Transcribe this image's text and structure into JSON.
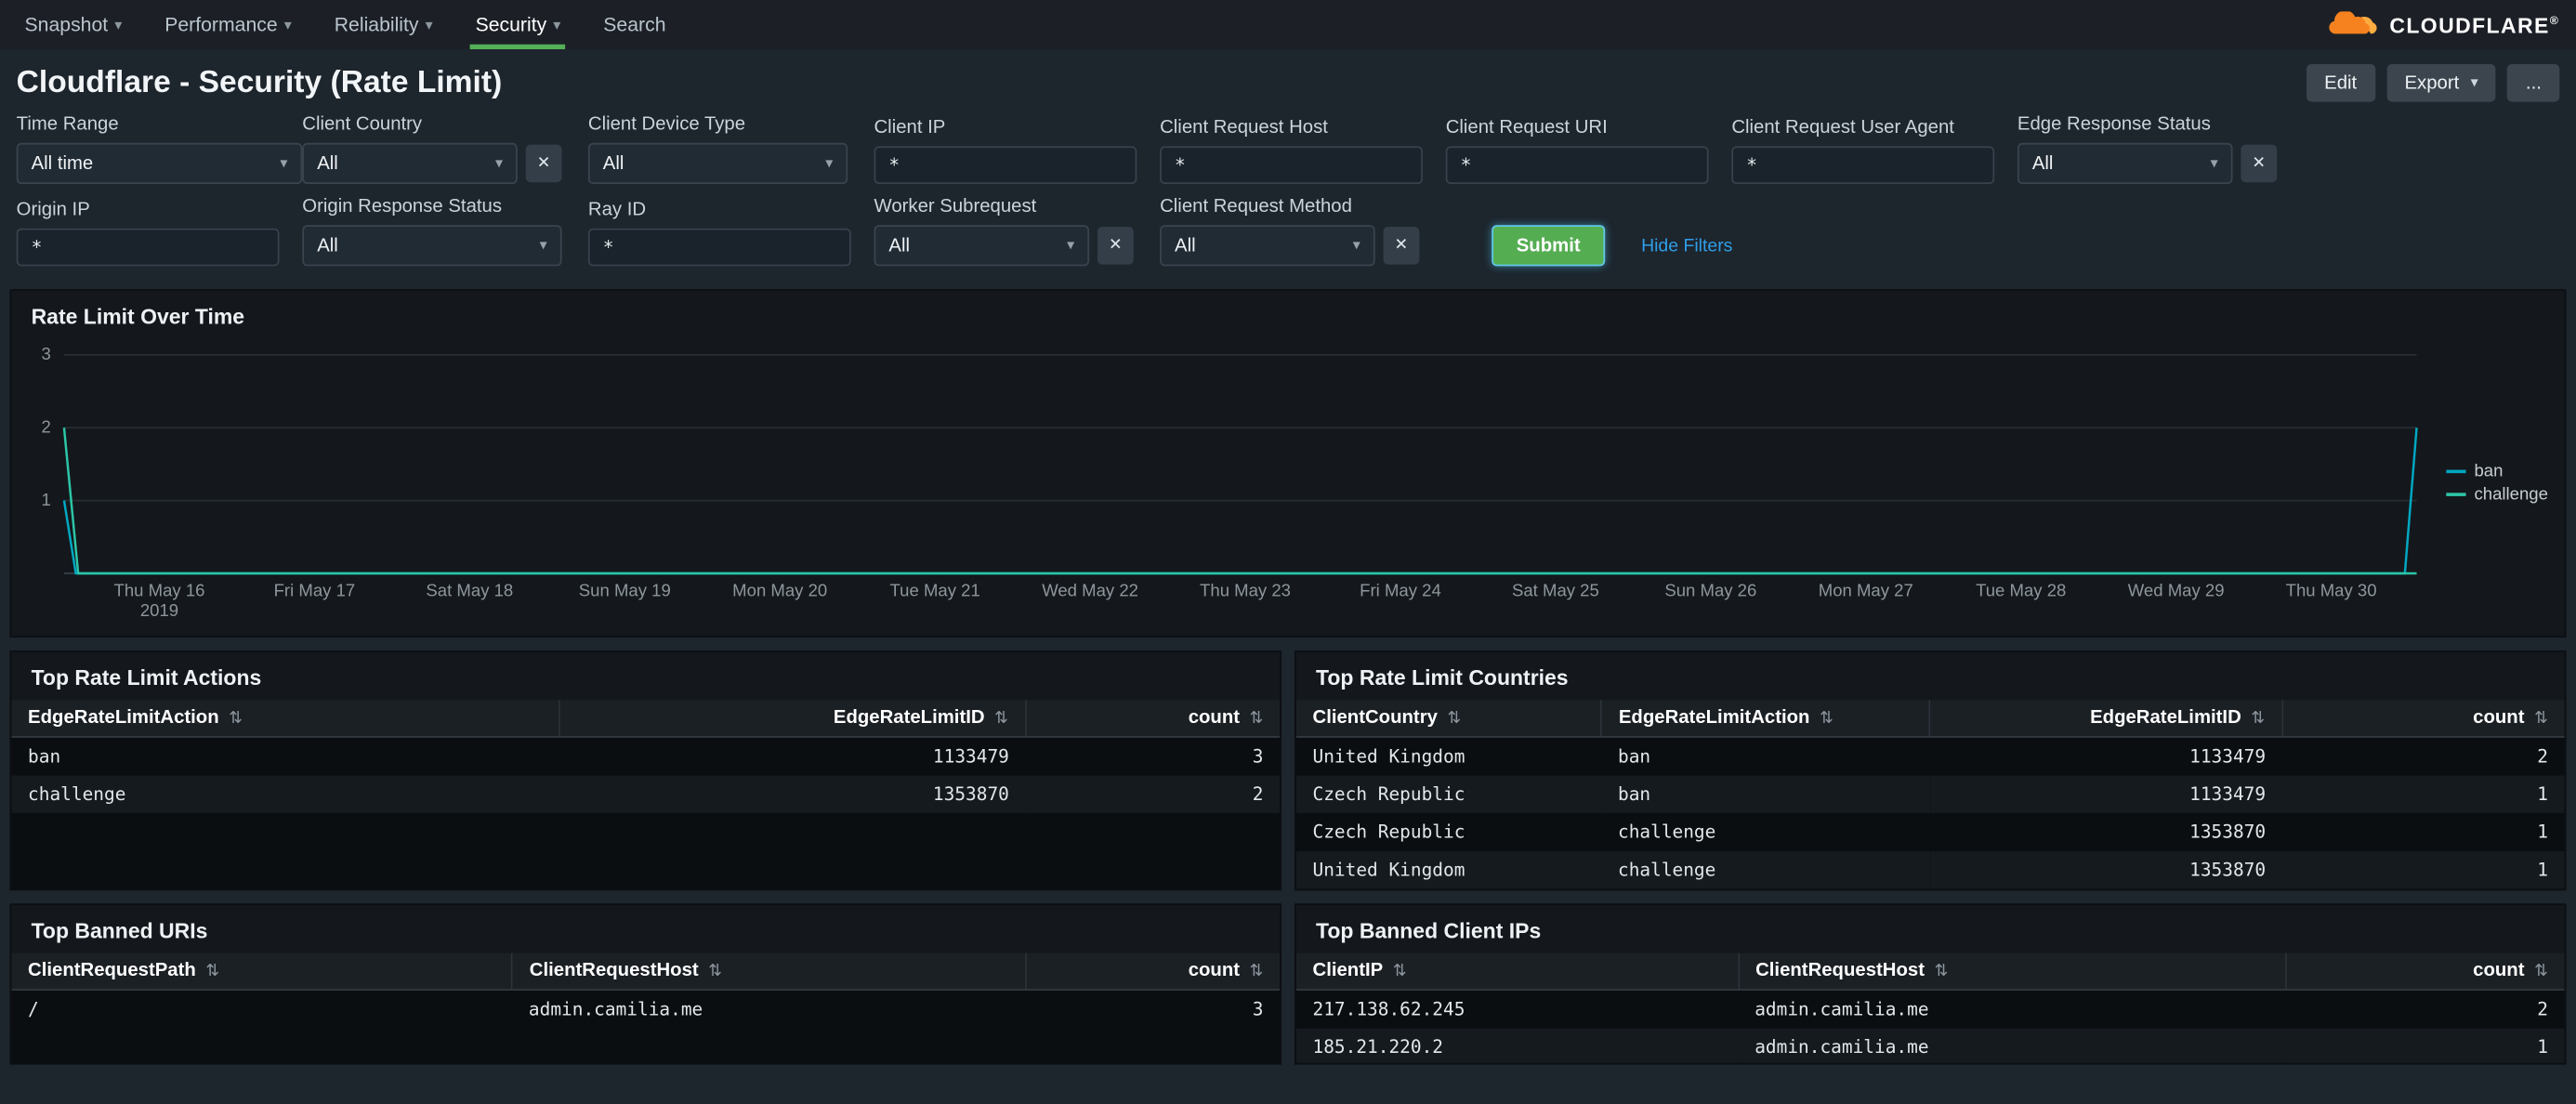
{
  "icons": {
    "caret_down": "▾",
    "clear": "✕",
    "sort": "⇅"
  },
  "nav": {
    "brand": "CLOUDFLARE",
    "brand_registered": "®",
    "items": [
      {
        "label": "Snapshot"
      },
      {
        "label": "Performance"
      },
      {
        "label": "Reliability"
      },
      {
        "label": "Security"
      },
      {
        "label": "Search"
      }
    ]
  },
  "header": {
    "title": "Cloudflare - Security (Rate Limit)",
    "edit_label": "Edit",
    "export_label": "Export",
    "more_label": "..."
  },
  "filters": {
    "row1": [
      {
        "id": "time-range",
        "label": "Time Range",
        "type": "dropdown",
        "value": "All time",
        "clear": false
      },
      {
        "id": "client-country",
        "label": "Client Country",
        "type": "dropdown",
        "value": "All",
        "clear": true
      },
      {
        "id": "client-device-type",
        "label": "Client Device Type",
        "type": "dropdown",
        "value": "All",
        "clear": false
      },
      {
        "id": "client-ip",
        "label": "Client IP",
        "type": "input",
        "value": "*",
        "clear": false
      },
      {
        "id": "client-request-host",
        "label": "Client Request Host",
        "type": "input",
        "value": "*",
        "clear": false
      },
      {
        "id": "client-request-uri",
        "label": "Client Request URI",
        "type": "input",
        "value": "*",
        "clear": false
      },
      {
        "id": "client-request-user-agent",
        "label": "Client Request User Agent",
        "type": "input",
        "value": "*",
        "clear": false
      },
      {
        "id": "edge-response-status",
        "label": "Edge Response Status",
        "type": "dropdown",
        "value": "All",
        "clear": true
      }
    ],
    "row2": [
      {
        "id": "origin-ip",
        "label": "Origin IP",
        "type": "input",
        "value": "*",
        "clear": false
      },
      {
        "id": "origin-response-status",
        "label": "Origin Response Status",
        "type": "dropdown",
        "value": "All",
        "clear": false
      },
      {
        "id": "ray-id",
        "label": "Ray ID",
        "type": "input",
        "value": "*",
        "clear": false
      },
      {
        "id": "worker-subrequest",
        "label": "Worker Subrequest",
        "type": "dropdown",
        "value": "All",
        "clear": true
      },
      {
        "id": "client-request-method",
        "label": "Client Request Method",
        "type": "dropdown",
        "value": "All",
        "clear": true
      }
    ],
    "submit_label": "Submit",
    "hide_filters_label": "Hide Filters"
  },
  "chart_data": {
    "type": "line",
    "title": "Rate Limit Over Time",
    "x_ticks": [
      "Thu May 16",
      "Fri May 17",
      "Sat May 18",
      "Sun May 19",
      "Mon May 20",
      "Tue May 21",
      "Wed May 22",
      "Thu May 23",
      "Fri May 24",
      "Sat May 25",
      "Sun May 26",
      "Mon May 27",
      "Tue May 28",
      "Wed May 29",
      "Thu May 30"
    ],
    "x_sub_label": "2019",
    "ylim": [
      0,
      3
    ],
    "yticks": [
      1,
      2,
      3
    ],
    "grid": "horizontal",
    "legend_position": "right",
    "series": [
      {
        "name": "ban",
        "color": "#00a8c2",
        "points": [
          [
            0,
            1
          ],
          [
            0.005,
            0
          ],
          [
            0.995,
            0
          ],
          [
            1,
            2
          ]
        ]
      },
      {
        "name": "challenge",
        "color": "#2cc6a8",
        "points": [
          [
            0,
            2
          ],
          [
            0.006,
            0
          ],
          [
            1,
            0
          ]
        ]
      }
    ]
  },
  "tables": {
    "actions": {
      "title": "Top Rate Limit Actions",
      "columns": [
        {
          "label": "EdgeRateLimitAction",
          "align": "left"
        },
        {
          "label": "EdgeRateLimitID",
          "align": "right"
        },
        {
          "label": "count",
          "align": "right"
        }
      ],
      "rows": [
        [
          "ban",
          "1133479",
          "3"
        ],
        [
          "challenge",
          "1353870",
          "2"
        ]
      ]
    },
    "countries": {
      "title": "Top Rate Limit Countries",
      "columns": [
        {
          "label": "ClientCountry",
          "align": "left"
        },
        {
          "label": "EdgeRateLimitAction",
          "align": "left"
        },
        {
          "label": "EdgeRateLimitID",
          "align": "right"
        },
        {
          "label": "count",
          "align": "right"
        }
      ],
      "rows": [
        [
          "United Kingdom",
          "ban",
          "1133479",
          "2"
        ],
        [
          "Czech Republic",
          "ban",
          "1133479",
          "1"
        ],
        [
          "Czech Republic",
          "challenge",
          "1353870",
          "1"
        ],
        [
          "United Kingdom",
          "challenge",
          "1353870",
          "1"
        ]
      ]
    },
    "banned_uris": {
      "title": "Top Banned URIs",
      "columns": [
        {
          "label": "ClientRequestPath",
          "align": "left"
        },
        {
          "label": "ClientRequestHost",
          "align": "left"
        },
        {
          "label": "count",
          "align": "right"
        }
      ],
      "rows": [
        [
          "/",
          "admin.camilia.me",
          "3"
        ]
      ]
    },
    "banned_ips": {
      "title": "Top Banned Client IPs",
      "columns": [
        {
          "label": "ClientIP",
          "align": "left"
        },
        {
          "label": "ClientRequestHost",
          "align": "left"
        },
        {
          "label": "count",
          "align": "right"
        }
      ],
      "rows": [
        [
          "217.138.62.245",
          "admin.camilia.me",
          "2"
        ],
        [
          "185.21.220.2",
          "admin.camilia.me",
          "1"
        ]
      ]
    }
  }
}
